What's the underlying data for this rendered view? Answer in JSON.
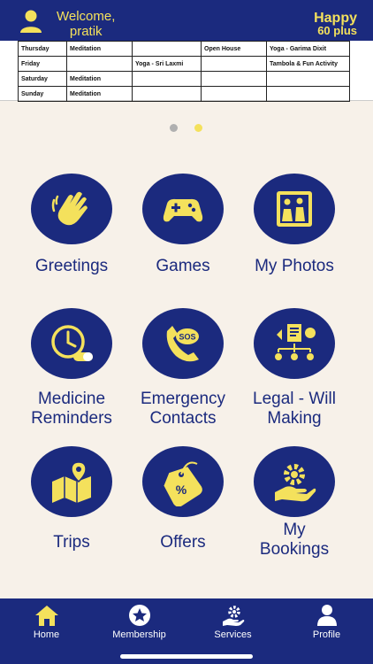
{
  "header": {
    "welcome_line1": "Welcome,",
    "welcome_line2": "pratik",
    "brand_line1": "Happy",
    "brand_line2": "60 plus"
  },
  "schedule": {
    "rows": [
      [
        "Thursday",
        "Meditation",
        "",
        "Open House",
        "Yoga - Garima Dixit"
      ],
      [
        "Friday",
        "",
        "Yoga - Sri Laxmi",
        "",
        "Tambola & Fun Activity"
      ],
      [
        "Saturday",
        "Meditation",
        "",
        "",
        ""
      ],
      [
        "Sunday",
        "Meditation",
        "",
        "",
        ""
      ]
    ]
  },
  "carousel": {
    "current": 2,
    "total": 2
  },
  "tiles": [
    {
      "line1": "Greetings",
      "line2": "",
      "icon": "waving-hand-icon"
    },
    {
      "line1": "Games",
      "line2": "",
      "icon": "gamepad-icon"
    },
    {
      "line1": "My Photos",
      "line2": "",
      "icon": "photo-album-icon"
    },
    {
      "line1": "Medicine",
      "line2": "Reminders",
      "icon": "clock-pill-icon"
    },
    {
      "line1": "Emergency",
      "line2": "Contacts",
      "icon": "sos-phone-icon"
    },
    {
      "line1": "Legal - Will",
      "line2": "Making",
      "icon": "legal-document-icon"
    },
    {
      "line1": "Trips",
      "line2": "",
      "icon": "map-pin-icon"
    },
    {
      "line1": "Offers",
      "line2": "",
      "icon": "discount-tag-icon"
    },
    {
      "line1": "My",
      "line2": "Bookings",
      "icon": "gear-hand-icon"
    }
  ],
  "nav": [
    {
      "label": "Home",
      "active": true,
      "icon": "home-icon"
    },
    {
      "label": "Membership",
      "active": false,
      "icon": "star-badge-icon"
    },
    {
      "label": "Services",
      "active": false,
      "icon": "gear-hand-icon"
    },
    {
      "label": "Profile",
      "active": false,
      "icon": "user-icon"
    }
  ],
  "colors": {
    "primary": "#1b2a7e",
    "accent": "#f4e15c",
    "background": "#f7f1e9"
  }
}
